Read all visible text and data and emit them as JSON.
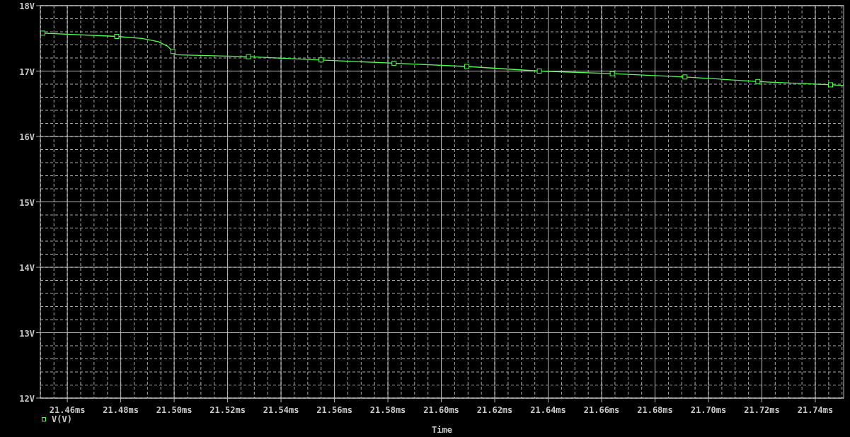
{
  "chart_data": {
    "type": "line",
    "xlabel": "Time",
    "x": [
      21.4508,
      21.4785,
      21.488,
      21.494,
      21.4975,
      21.4995,
      21.5006,
      21.5278,
      21.555,
      21.5823,
      21.6095,
      21.6367,
      21.664,
      21.6912,
      21.7185,
      21.7457,
      21.7506
    ],
    "series": [
      {
        "name": "V(V)",
        "color": "#50ff50",
        "values": [
          17.58,
          17.53,
          17.5,
          17.45,
          17.38,
          17.3,
          17.25,
          17.22,
          17.17,
          17.12,
          17.07,
          17.0,
          16.96,
          16.91,
          16.84,
          16.79,
          16.78
        ]
      }
    ],
    "grid": true,
    "xlim": [
      21.4499,
      21.7506
    ],
    "ylim": [
      12,
      18
    ],
    "xticks": [
      {
        "value": 21.46,
        "label": "21.46ms"
      },
      {
        "value": 21.48,
        "label": "21.48ms"
      },
      {
        "value": 21.5,
        "label": "21.50ms"
      },
      {
        "value": 21.52,
        "label": "21.52ms"
      },
      {
        "value": 21.54,
        "label": "21.54ms"
      },
      {
        "value": 21.56,
        "label": "21.56ms"
      },
      {
        "value": 21.58,
        "label": "21.58ms"
      },
      {
        "value": 21.6,
        "label": "21.60ms"
      },
      {
        "value": 21.62,
        "label": "21.62ms"
      },
      {
        "value": 21.64,
        "label": "21.64ms"
      },
      {
        "value": 21.66,
        "label": "21.66ms"
      },
      {
        "value": 21.68,
        "label": "21.68ms"
      },
      {
        "value": 21.7,
        "label": "21.70ms"
      },
      {
        "value": 21.72,
        "label": "21.72ms"
      },
      {
        "value": 21.74,
        "label": "21.74ms"
      }
    ],
    "yticks": [
      {
        "value": 12,
        "label": "12V"
      },
      {
        "value": 13,
        "label": "13V"
      },
      {
        "value": 14,
        "label": "14V"
      },
      {
        "value": 15,
        "label": "15V"
      },
      {
        "value": 16,
        "label": "16V"
      },
      {
        "value": 17,
        "label": "17V"
      },
      {
        "value": 18,
        "label": "18V"
      }
    ]
  }
}
